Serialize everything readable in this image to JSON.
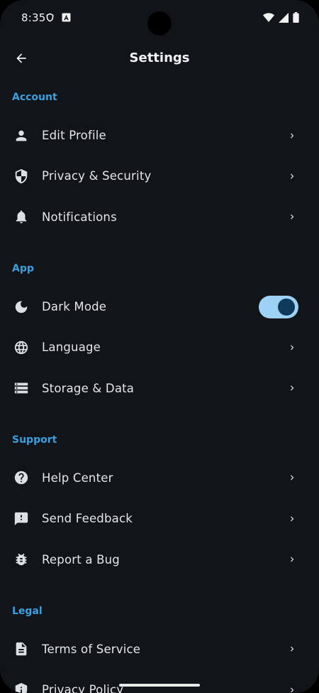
{
  "status_bar": {
    "time": "8:35"
  },
  "app_bar": {
    "title": "Settings",
    "back_icon": "arrow-back-icon"
  },
  "sections": {
    "account": {
      "title": "Account",
      "items": [
        {
          "label": "Edit Profile",
          "icon": "person-icon"
        },
        {
          "label": "Privacy & Security",
          "icon": "shield-icon"
        },
        {
          "label": "Notifications",
          "icon": "bell-icon"
        }
      ]
    },
    "app": {
      "title": "App",
      "items": [
        {
          "label": "Dark Mode",
          "icon": "moon-icon",
          "toggle": true
        },
        {
          "label": "Language",
          "icon": "globe-icon"
        },
        {
          "label": "Storage & Data",
          "icon": "storage-icon"
        }
      ]
    },
    "support": {
      "title": "Support",
      "items": [
        {
          "label": "Help Center",
          "icon": "help-icon"
        },
        {
          "label": "Send Feedback",
          "icon": "feedback-icon"
        },
        {
          "label": "Report a Bug",
          "icon": "bug-icon"
        }
      ]
    },
    "legal": {
      "title": "Legal",
      "items": [
        {
          "label": "Terms of Service",
          "icon": "document-icon"
        },
        {
          "label": "Privacy Policy",
          "icon": "privacy-shield-icon"
        }
      ]
    }
  },
  "colors": {
    "background": "#111418",
    "section_header": "#3aa0e0",
    "toggle_track": "#9dd1f5",
    "toggle_knob": "#0f3a5a"
  }
}
